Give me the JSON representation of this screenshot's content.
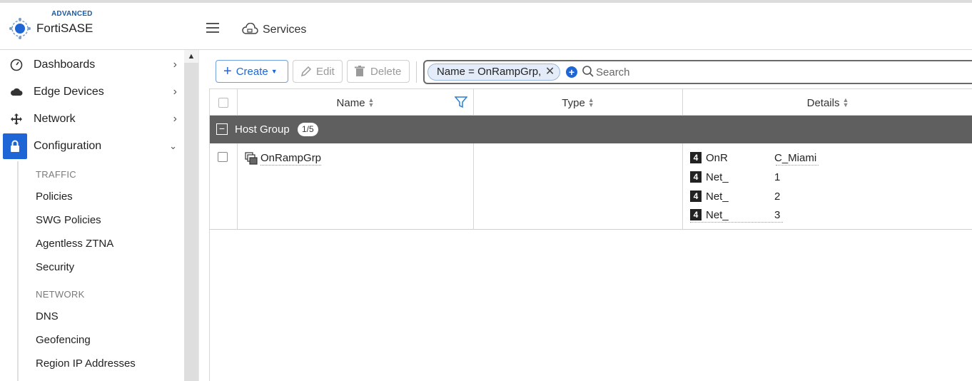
{
  "brand": {
    "tag": "ADVANCED",
    "name": "FortiSASE"
  },
  "breadcrumb": {
    "label": "Services"
  },
  "sidebar": {
    "items": [
      {
        "label": "Dashboards",
        "icon": "dashboard-gauge-icon"
      },
      {
        "label": "Edge Devices",
        "icon": "cloud-icon"
      },
      {
        "label": "Network",
        "icon": "network-arrows-icon"
      },
      {
        "label": "Configuration",
        "icon": "lock-icon"
      }
    ],
    "sections": [
      {
        "title": "TRAFFIC",
        "items": [
          "Policies",
          "SWG Policies",
          "Agentless ZTNA",
          "Security"
        ]
      },
      {
        "title": "NETWORK",
        "items": [
          "DNS",
          "Geofencing",
          "Region IP Addresses"
        ]
      }
    ]
  },
  "toolbar": {
    "create": "Create",
    "edit": "Edit",
    "delete": "Delete"
  },
  "search": {
    "filter_chip": "Name = OnRampGrp,",
    "placeholder": "Search"
  },
  "table": {
    "columns": [
      "Name",
      "Type",
      "Details"
    ],
    "group": {
      "label": "Host Group",
      "count": "1/5"
    },
    "rows": [
      {
        "name": "OnRampGrp",
        "type": "",
        "details": [
          {
            "badge": "4",
            "a": "OnR",
            "b": "C_Miami"
          },
          {
            "badge": "4",
            "a": "Net_",
            "b": "1"
          },
          {
            "badge": "4",
            "a": "Net_",
            "b": "2"
          },
          {
            "badge": "4",
            "a": "Net_",
            "b": "3"
          }
        ]
      }
    ]
  },
  "colors": {
    "accent": "#1e66d6",
    "group_bar": "#5f5f5f"
  }
}
